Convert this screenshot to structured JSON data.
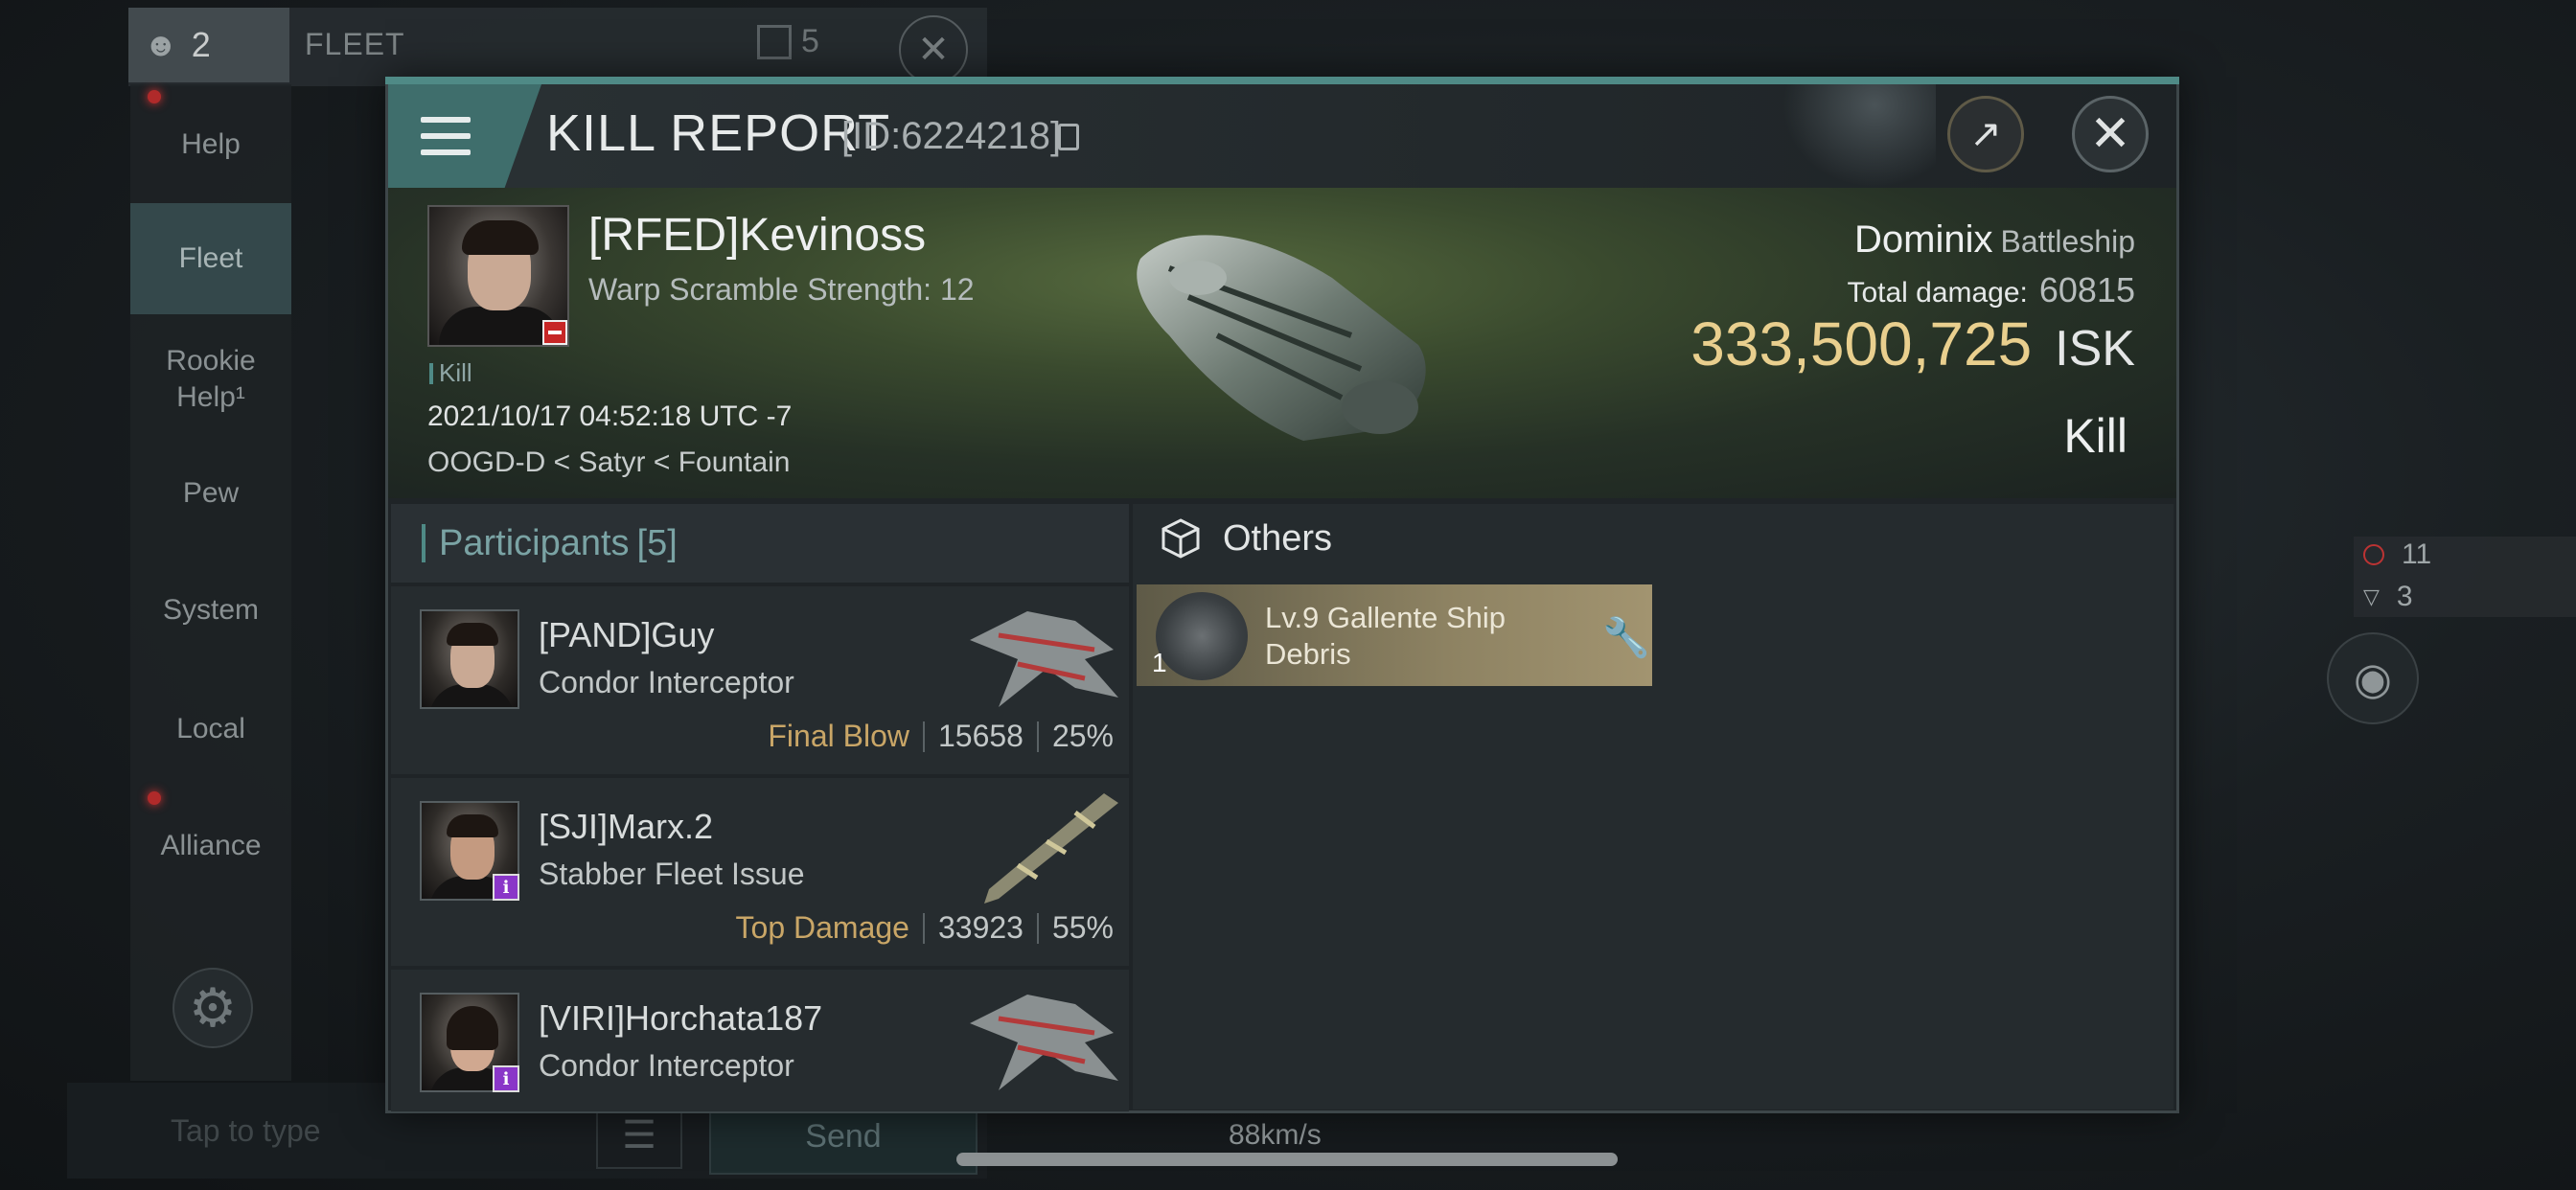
{
  "background": {
    "crew_count": "2",
    "fleet_label": "FLEET",
    "member_count": "5",
    "sidebar": [
      {
        "label": "Help"
      },
      {
        "label": "Fleet"
      },
      {
        "label": "Rookie Help¹"
      },
      {
        "label": "Pew"
      },
      {
        "label": "System"
      },
      {
        "label": "Local"
      },
      {
        "label": "Alliance"
      }
    ],
    "chat_placeholder": "Tap to type",
    "send_label": "Send",
    "speed": "88km/s"
  },
  "hud": {
    "hostiles": "11",
    "overview_count": "3"
  },
  "report": {
    "title": "KILL REPORT",
    "id": "[ID:6224218]",
    "victim": {
      "name": "[RFED]Kevinoss",
      "warp_scramble": "Warp Scramble Strength: 12",
      "tag": "Kill",
      "time": "2021/10/17 04:52:18 UTC -7",
      "location": "OOGD-D < Satyr < Fountain"
    },
    "ship": {
      "name": "Dominix",
      "class": "Battleship",
      "total_damage_label": "Total damage:",
      "total_damage": "60815",
      "isk_value": "333,500,725",
      "isk_unit": "ISK",
      "result": "Kill"
    },
    "participants": {
      "label": "Participants",
      "count": "[5]",
      "rows": [
        {
          "name": "[PAND]Guy",
          "ship": "Condor Interceptor",
          "tag": "Final Blow",
          "damage": "15658",
          "percent": "25%"
        },
        {
          "name": "[SJI]Marx.2",
          "ship": "Stabber Fleet Issue",
          "tag": "Top Damage",
          "damage": "33923",
          "percent": "55%"
        },
        {
          "name": "[VIRI]Horchata187",
          "ship": "Condor Interceptor",
          "tag": "",
          "damage": "",
          "percent": ""
        }
      ]
    },
    "others": {
      "label": "Others",
      "items": [
        {
          "name": "Lv.9 Gallente Ship Debris",
          "qty": "1"
        }
      ]
    }
  },
  "colors": {
    "accent": "#4f8a86",
    "isk": "#e9cf8e",
    "tag_gold": "#c9a667",
    "alert_red": "#c72626"
  }
}
